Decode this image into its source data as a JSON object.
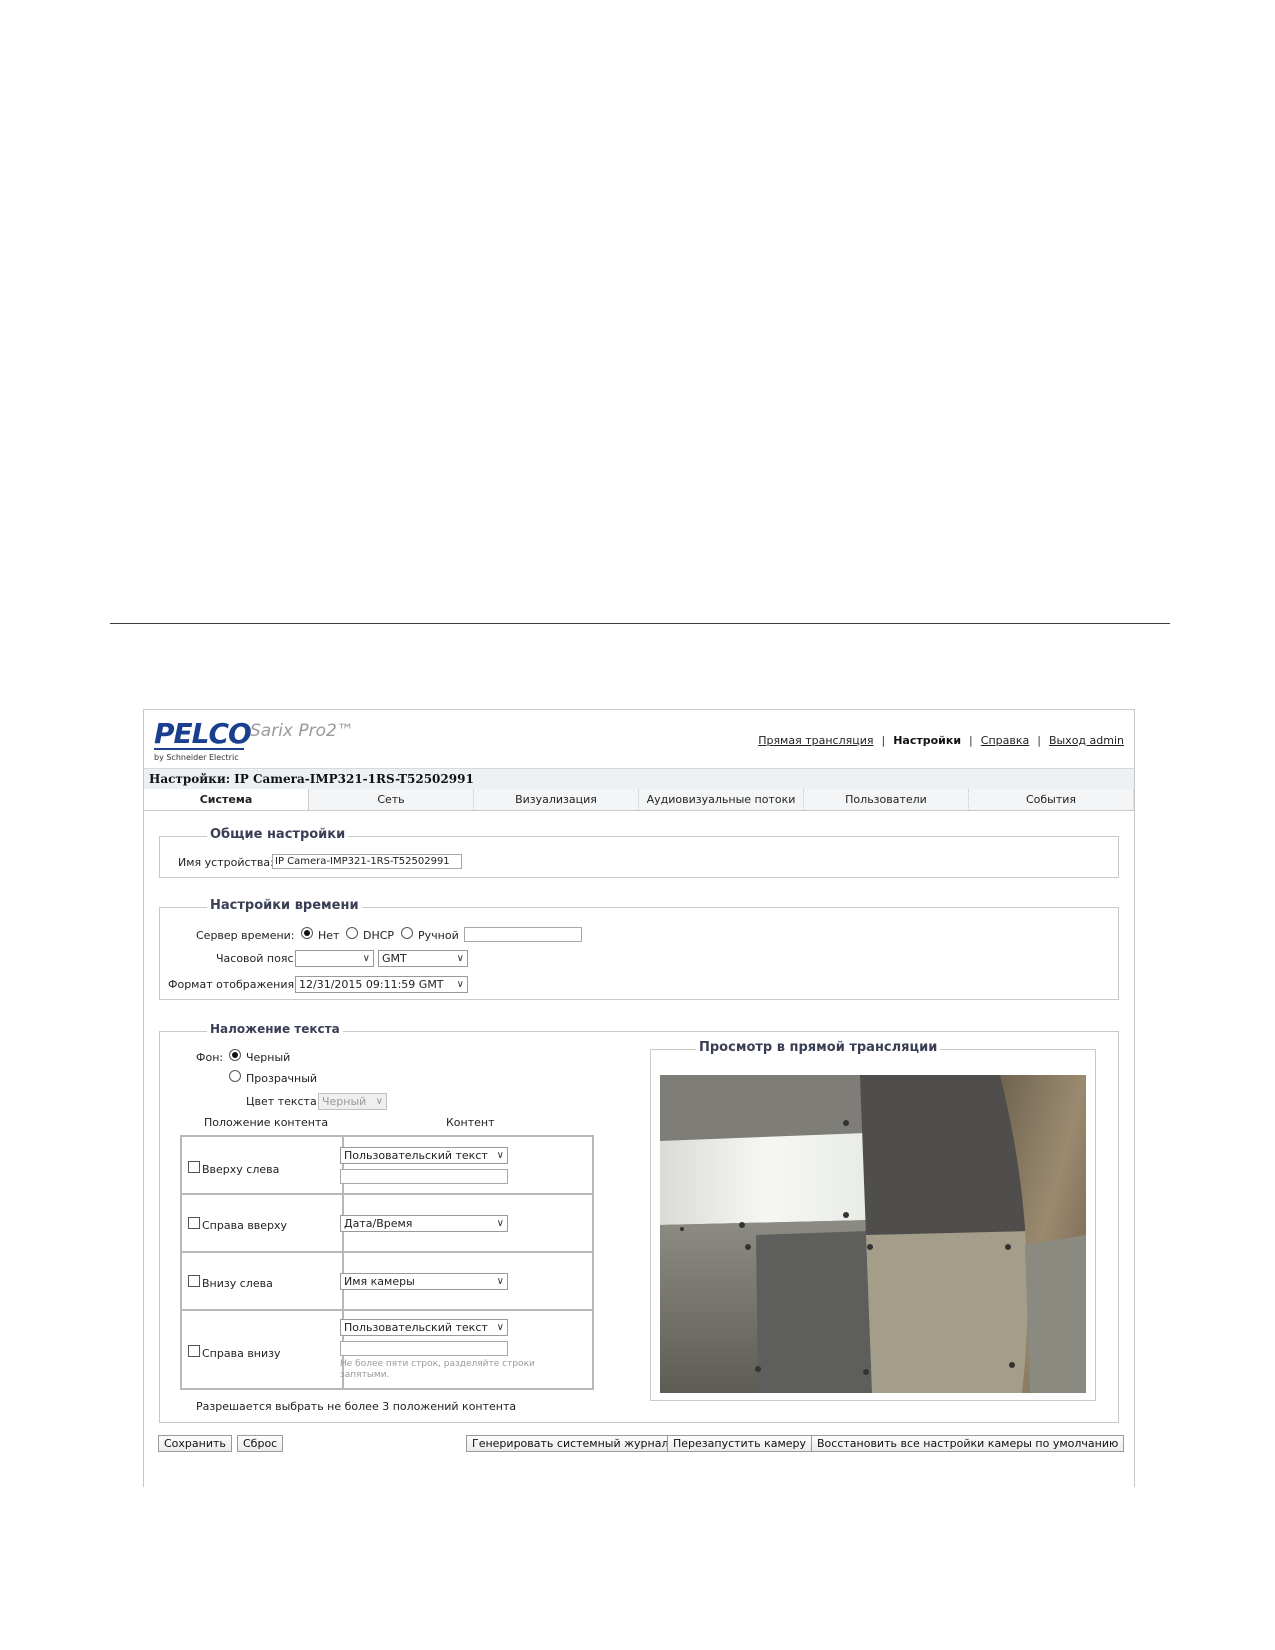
{
  "header": {
    "logo": "PELCO",
    "product": "Sarix Pro2™",
    "logo_sub": "by Schneider Electric",
    "nav": {
      "live": "Прямая трансляция",
      "settings": "Настройки",
      "help": "Справка",
      "logout": "Выход admin"
    }
  },
  "title": {
    "prefix": "Настройки:",
    "device": "IP Camera-IMP321-1RS-T52502991"
  },
  "tabs": [
    "Система",
    "Сеть",
    "Визуализация",
    "Аудиовизуальные потоки",
    "Пользователи",
    "События"
  ],
  "general": {
    "legend": "Общие настройки",
    "device_name_label": "Имя устройства:",
    "device_name_value": "IP Camera-IMP321-1RS-T52502991"
  },
  "time": {
    "legend": "Настройки времени",
    "server_label": "Сервер времени:",
    "server_options": [
      "Нет",
      "DHCP",
      "Ручной"
    ],
    "server_selected": "Нет",
    "manual_value": "",
    "timezone_label": "Часовой пояс",
    "timezone_region": "",
    "timezone_value": "GMT",
    "format_label": "Формат отображения:",
    "format_value": "12/31/2015 09:11:59 GMT"
  },
  "overlay": {
    "legend": "Наложение текста",
    "background_label": "Фон:",
    "background_options": [
      "Черный",
      "Прозрачный"
    ],
    "background_selected": "Черный",
    "text_color_label": "Цвет текста",
    "text_color_value": "Черный",
    "col_position": "Положение контента",
    "col_content": "Контент",
    "rows": [
      {
        "position": "Вверху слева",
        "checked": false,
        "content": "Пользовательский текст",
        "text": ""
      },
      {
        "position": "Справа вверху",
        "checked": false,
        "content": "Дата/Время"
      },
      {
        "position": "Внизу слева",
        "checked": false,
        "content": "Имя камеры"
      },
      {
        "position": "Справа внизу",
        "checked": false,
        "content": "Пользовательский текст",
        "text": "",
        "hint": "Не более пяти строк, разделяйте строки запятыми."
      }
    ],
    "limit_note": "Разрешается выбрать не более 3 положений контента",
    "preview_legend": "Просмотр в прямой трансляции"
  },
  "buttons": {
    "save": "Сохранить",
    "reset": "Сброс",
    "gen_log": "Генерировать системный журнал",
    "restart": "Перезапустить камеру",
    "restore": "Восстановить все настройки камеры по умолчанию"
  }
}
